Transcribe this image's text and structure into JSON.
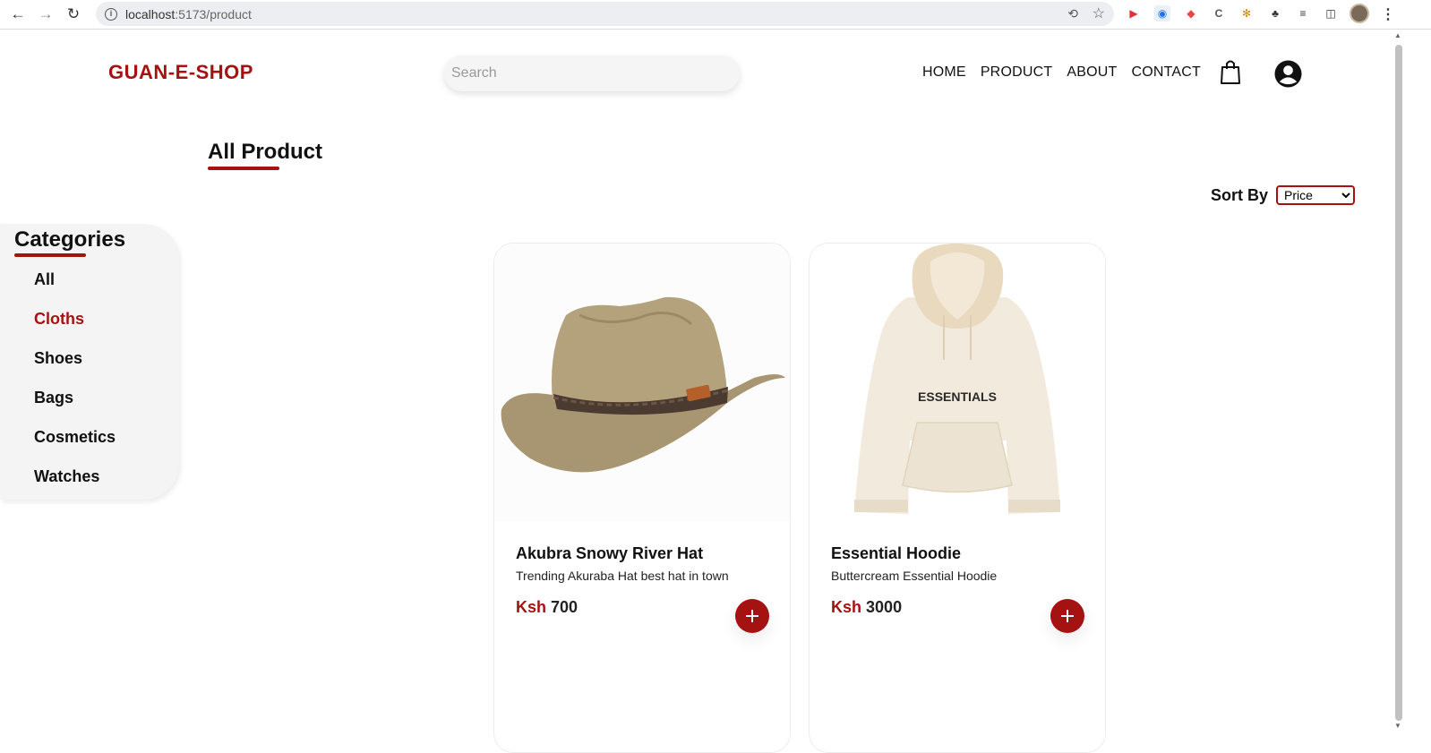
{
  "browser": {
    "url_host": "localhost",
    "url_path": ":5173/product"
  },
  "header": {
    "brand": "GUAN-E-SHOP",
    "search_placeholder": "Search",
    "nav": [
      "HOME",
      "PRODUCT",
      "ABOUT",
      "CONTACT"
    ],
    "accent_color": "#a51212"
  },
  "page": {
    "title": "All Product",
    "sort_label": "Sort By",
    "sort_value": "Price"
  },
  "categories": {
    "title": "Categories",
    "items": [
      "All",
      "Cloths",
      "Shoes",
      "Bags",
      "Cosmetics",
      "Watches"
    ],
    "active": "Cloths"
  },
  "products": [
    {
      "name": "Akubra Snowy River Hat",
      "description": "Trending Akuraba Hat best hat in town",
      "currency": "Ksh",
      "price": "700",
      "image": "hat"
    },
    {
      "name": "Essential Hoodie",
      "description": "Buttercream Essential Hoodie",
      "currency": "Ksh",
      "price": "3000",
      "image": "hoodie",
      "image_text": "ESSENTIALS"
    }
  ]
}
